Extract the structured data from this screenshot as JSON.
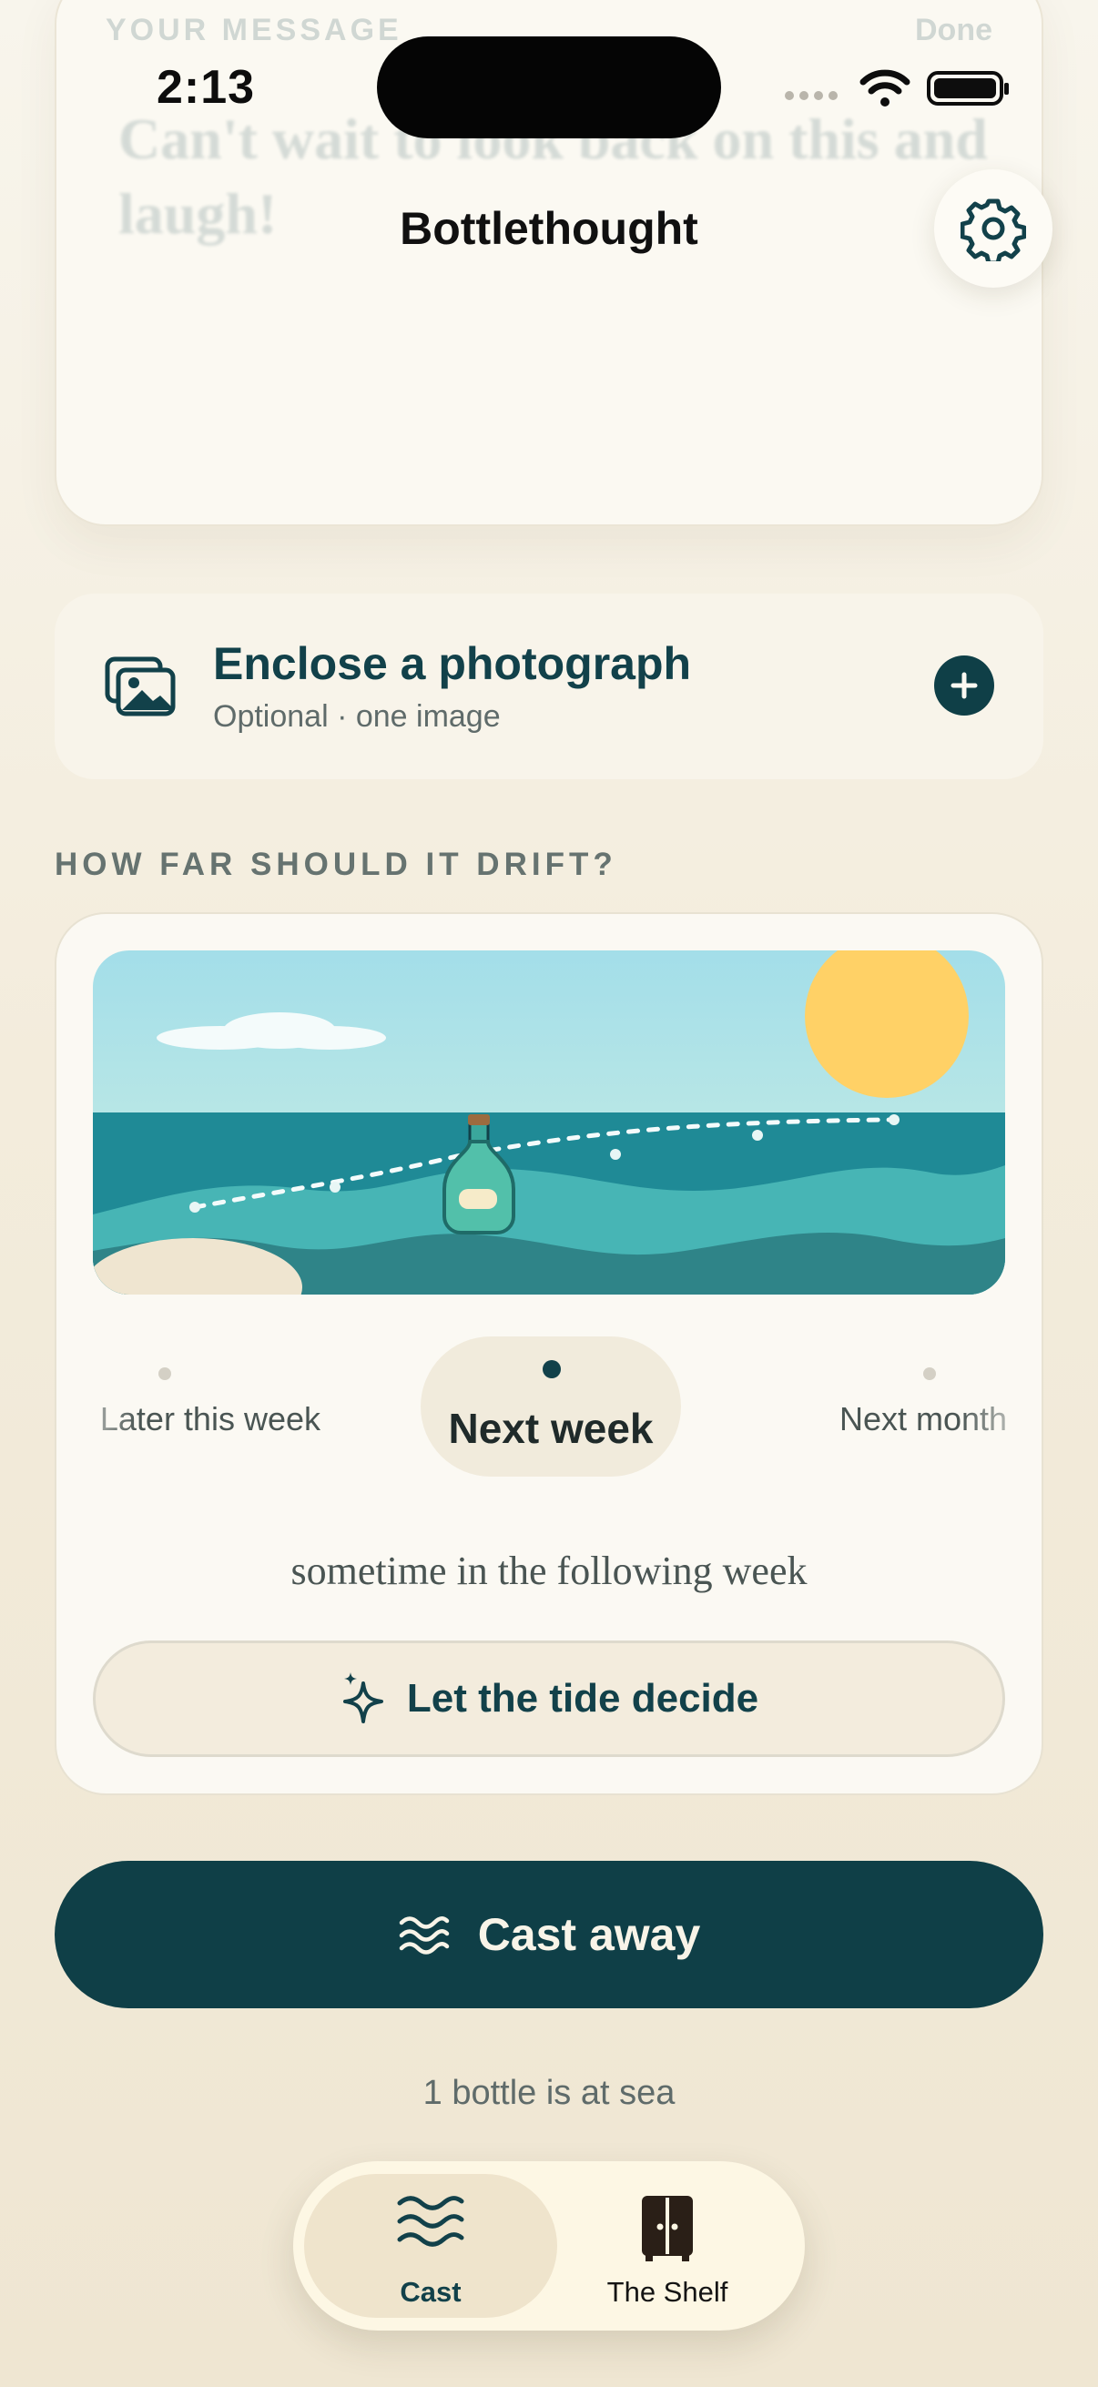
{
  "status_bar": {
    "time": "2:13"
  },
  "header": {
    "ghost_label": "YOUR MESSAGE",
    "ghost_action": "Done",
    "title": "Bottlethought"
  },
  "message": {
    "text": "Can't wait to look back on this and laugh!"
  },
  "photo": {
    "title": "Enclose a photograph",
    "subtitle": "Optional · one image"
  },
  "drift": {
    "section_label": "HOW FAR SHOULD IT DRIFT?",
    "options": {
      "previous": "Later this week",
      "selected": "Next week",
      "next": "Next month"
    },
    "description": "sometime in the following week",
    "random_label": "Let the tide decide"
  },
  "cast": {
    "label": "Cast away"
  },
  "at_sea": "1 bottle is at sea",
  "tabs": {
    "cast": "Cast",
    "shelf": "The Shelf"
  },
  "colors": {
    "accent": "#0f3f47",
    "background": "#f6f1e4",
    "sea": "#1f8a96",
    "sun": "#ffd166",
    "sky": "#a7e0ea"
  },
  "icons": {
    "settings": "gear-icon",
    "photo": "photos-icon",
    "add": "plus-icon",
    "random": "sparkle-icon",
    "cast": "waves-icon",
    "shelf": "cabinet-icon"
  }
}
